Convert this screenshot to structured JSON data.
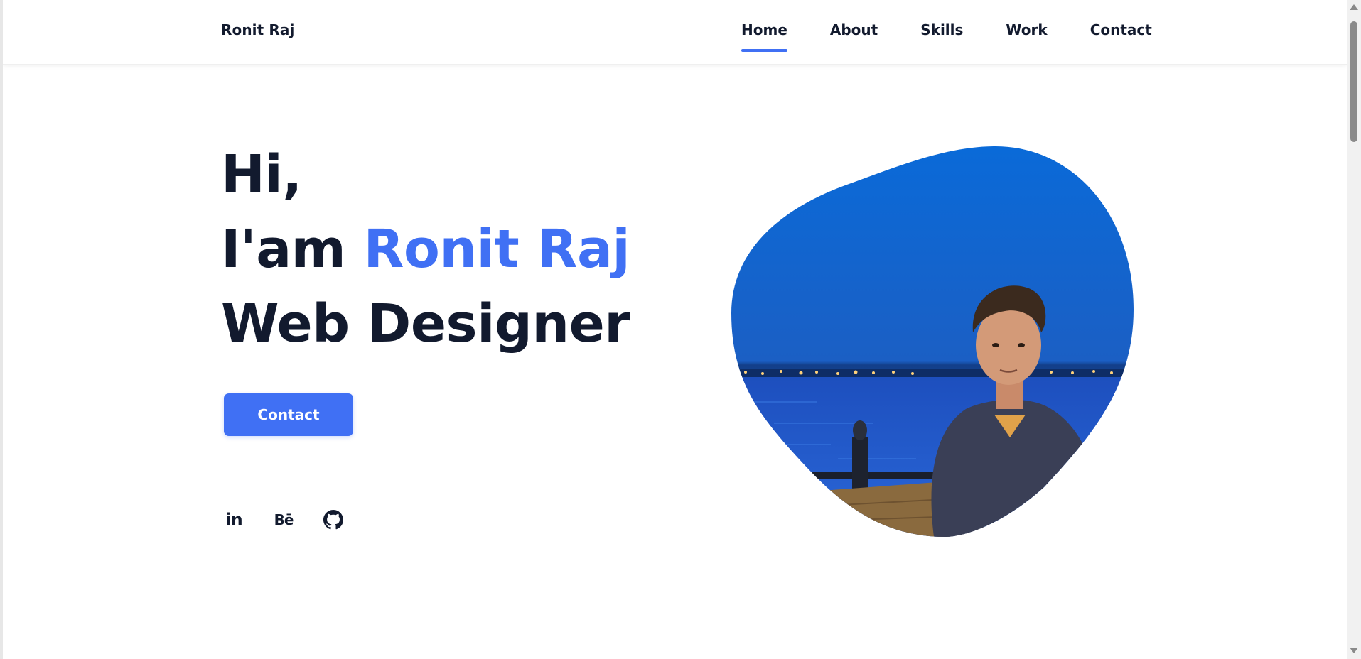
{
  "header": {
    "logo": "Ronit Raj",
    "nav": [
      {
        "label": "Home",
        "active": true
      },
      {
        "label": "About",
        "active": false
      },
      {
        "label": "Skills",
        "active": false
      },
      {
        "label": "Work",
        "active": false
      },
      {
        "label": "Contact",
        "active": false
      }
    ]
  },
  "hero": {
    "line1": "Hi,",
    "line2_prefix": "I'am ",
    "name": "Ronit Raj",
    "line3": "Web Designer",
    "button_label": "Contact"
  },
  "social": {
    "linkedin": "in",
    "behance": "Bē",
    "github_icon": "github-icon"
  },
  "photo": {
    "icon": "profile-photo"
  },
  "colors": {
    "accent": "#4070f4",
    "text": "#121a2e",
    "background": "#ffffff"
  }
}
